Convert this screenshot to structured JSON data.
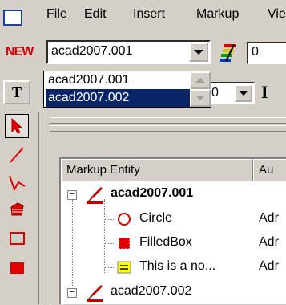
{
  "menu": {
    "items": [
      "File",
      "Edit",
      "Insert",
      "Markup",
      "Vie"
    ]
  },
  "toolbar": {
    "new_logo": "NEW",
    "document_combo_value": "acad2007.001",
    "layer_combo_value": "0",
    "lineweight_combo_value": "0",
    "text_tool_label": "T",
    "separator_glyph": "I"
  },
  "dropdown": {
    "options": [
      "acad2007.001",
      "acad2007.002"
    ],
    "selected_index": 1
  },
  "tools": [
    "select-arrow",
    "line",
    "polyline",
    "filled-polygon",
    "rectangle",
    "filled-rectangle"
  ],
  "table": {
    "columns": [
      "Markup Entity",
      "Au"
    ],
    "rows": [
      {
        "label": "acad2007.001",
        "author": "",
        "bold": true,
        "level": 0,
        "expander": "−",
        "icon": "red-pen-icon"
      },
      {
        "label": "Circle",
        "author": "Adr",
        "bold": false,
        "level": 1,
        "icon": "circle-icon"
      },
      {
        "label": "FilledBox",
        "author": "Adr",
        "bold": false,
        "level": 1,
        "icon": "filled-box-icon"
      },
      {
        "label": "This is a no...",
        "author": "Adr",
        "bold": false,
        "level": 1,
        "icon": "note-icon"
      },
      {
        "label": "acad2007.002",
        "author": "",
        "bold": false,
        "level": 0,
        "expander": "−",
        "icon": "red-pen-icon"
      }
    ]
  },
  "colors": {
    "accent_red": "#e00000",
    "selection": "#0a246a"
  }
}
